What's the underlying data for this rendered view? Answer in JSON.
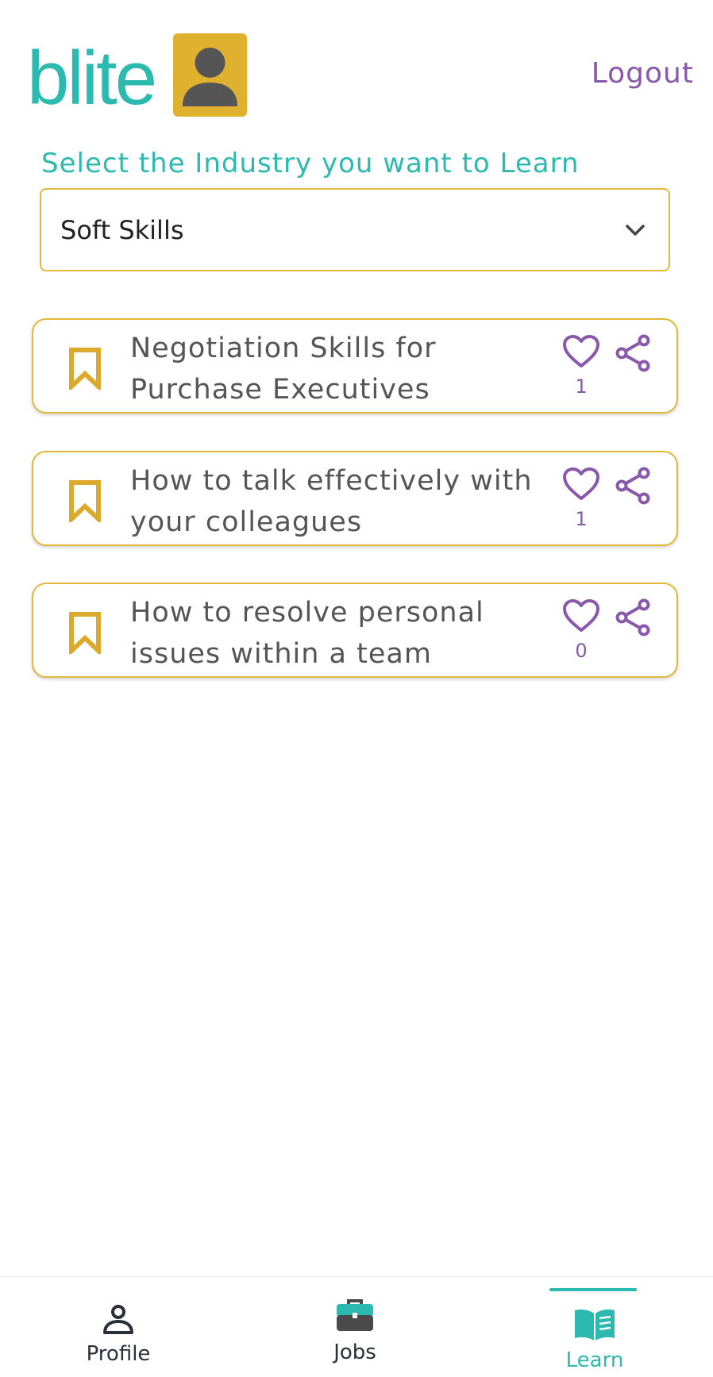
{
  "app": {
    "logo_text": "blite",
    "logout_label": "Logout"
  },
  "colors": {
    "brand_teal": "#2bb9b0",
    "accent_purple": "#8a58ab",
    "border_gold": "#e2b83a",
    "avatar_bg": "#e0b12e"
  },
  "industry": {
    "label": "Select the Industry you want to Learn",
    "selected": "Soft Skills"
  },
  "courses": [
    {
      "title_line1": "Negotiation Skills for",
      "title_line2": "Purchase Executives",
      "likes": "1"
    },
    {
      "title_line1": "How to talk effectively with",
      "title_line2": "your colleagues",
      "likes": "1"
    },
    {
      "title_line1": "How to resolve personal",
      "title_line2": "issues within a team",
      "likes": "0"
    }
  ],
  "nav": {
    "items": [
      {
        "label": "Profile",
        "icon": "person-icon"
      },
      {
        "label": "Jobs",
        "icon": "briefcase-icon"
      },
      {
        "label": "Learn",
        "icon": "book-icon"
      }
    ],
    "active": "Learn"
  }
}
